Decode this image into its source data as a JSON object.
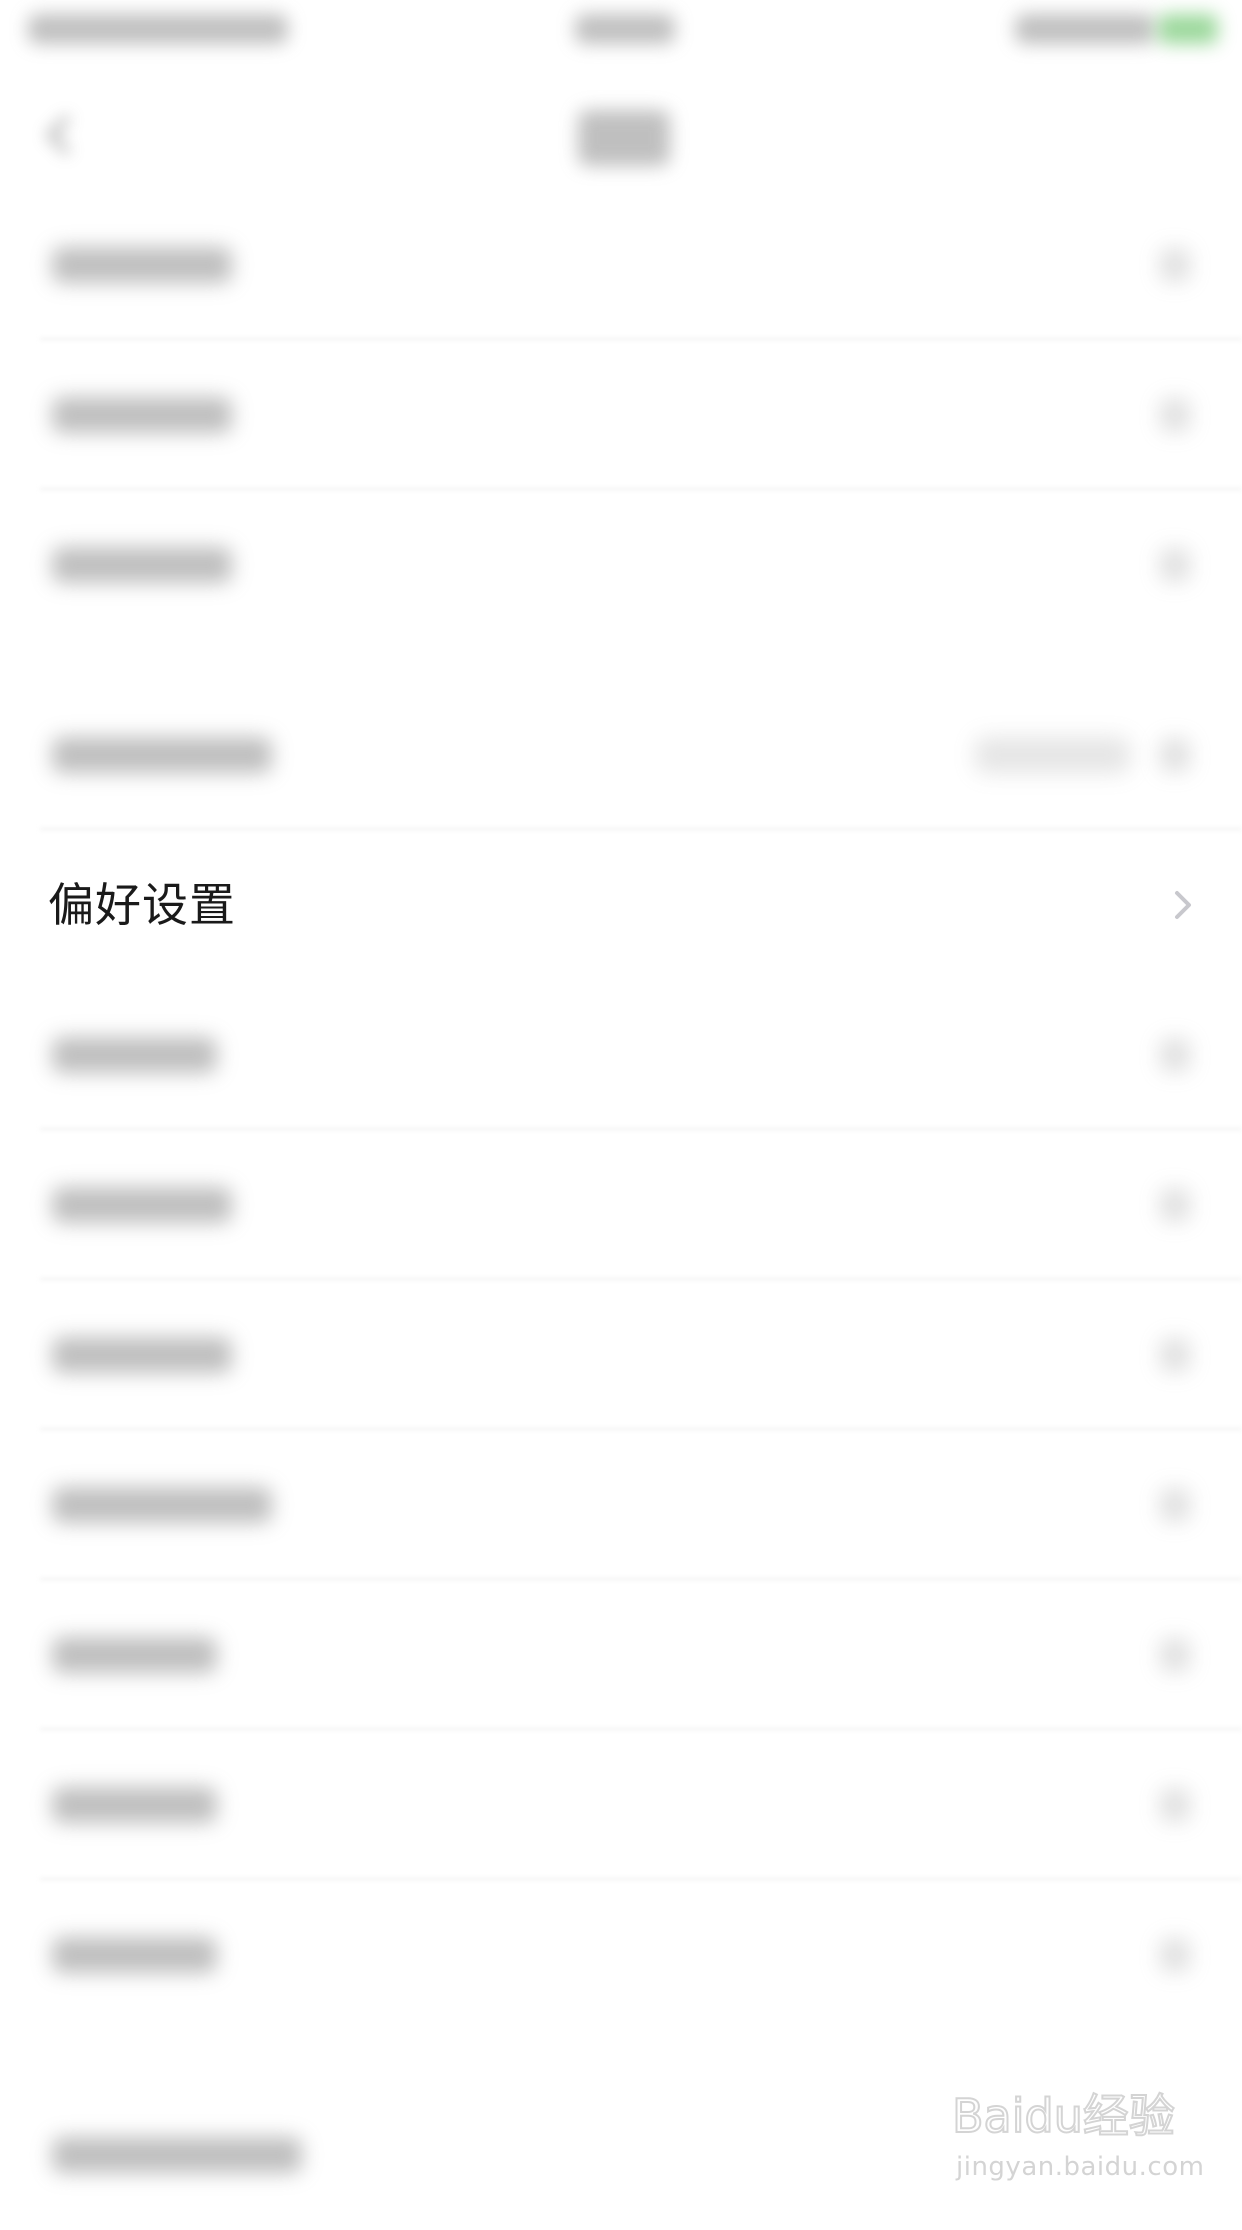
{
  "settings": {
    "focused_item": {
      "label": "偏好设置"
    }
  },
  "watermark": {
    "brand": "Baidu经验",
    "url": "jingyan.baidu.com"
  },
  "colors": {
    "background": "#ffffff",
    "text": "#1a1a1a",
    "chevron": "#c8c8cd",
    "battery": "#5bbf5b",
    "watermark": "#d4d4d4"
  },
  "icons": {
    "back": "back-icon",
    "chevron": "chevron-right-icon",
    "battery": "battery-icon",
    "watermark_logo": "baidu-paw-icon"
  }
}
